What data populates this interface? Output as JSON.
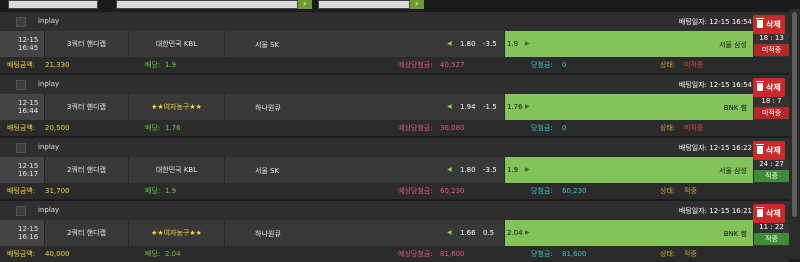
{
  "labels": {
    "inplay": "inplay",
    "delete": "삭제",
    "bet_amount": "배팅금액:",
    "odds": "배당:",
    "expected": "예상당첨금:",
    "won": "당첨금:",
    "status": "상태:"
  },
  "colors": {
    "delete_bg": "#cc2a2a",
    "away_cell_bg": "#83c45a",
    "status_pending": "#b52626",
    "status_won": "#3e8b3a",
    "amount_text": "#f2d43a"
  },
  "bets": [
    {
      "bet_time": "배팅일자: 12-15 16:54",
      "match_date": "12-15",
      "match_time": "16:45",
      "game_type": "3쿼터 핸디캡",
      "league": "대한민국 KBL",
      "home_team": "서울 SK",
      "home_odds": "1.80",
      "handicap": "-3.5",
      "away_odds": "1.9",
      "away_team": "서울 삼성",
      "score": "18 : 13",
      "state": "미적중",
      "state_kind": "red",
      "amount": "21,330",
      "odds": "1.9",
      "expected": "40,527",
      "won": "0",
      "status": "미적중",
      "status_kind": "red"
    },
    {
      "bet_time": "배팅일자: 12-15 16:54",
      "match_date": "12-15",
      "match_time": "16:44",
      "game_type": "3쿼터 핸디캡",
      "league": "★★여자농구★★",
      "home_team": "하나원큐",
      "home_odds": "1.94",
      "handicap": "-1.5",
      "away_odds": "1.76",
      "away_team": "BNK 썸",
      "score": "18 : 7",
      "state": "미적중",
      "state_kind": "red",
      "amount": "20,500",
      "odds": "1.76",
      "expected": "36,080",
      "won": "0",
      "status": "미적중",
      "status_kind": "red"
    },
    {
      "bet_time": "배팅일자: 12-15 16:22",
      "match_date": "12-15",
      "match_time": "16:17",
      "game_type": "2쿼터 핸디캡",
      "league": "대한민국 KBL",
      "home_team": "서울 SK",
      "home_odds": "1.80",
      "handicap": "-3.5",
      "away_odds": "1.9",
      "away_team": "서울 삼성",
      "score": "24 : 27",
      "state": "적중",
      "state_kind": "green",
      "amount": "31,700",
      "odds": "1.9",
      "expected": "60,230",
      "won": "60,230",
      "status": "적중",
      "status_kind": "green"
    },
    {
      "bet_time": "배팅일자: 12-15 16:21",
      "match_date": "12-15",
      "match_time": "16:16",
      "game_type": "2쿼터 핸디캡",
      "league": "★★여자농구★★",
      "home_team": "하나원큐",
      "home_odds": "1.66",
      "handicap": "0.5",
      "away_odds": "2.04",
      "away_team": "BNK 썸",
      "score": "11 : 22",
      "state": "적중",
      "state_kind": "green",
      "amount": "40,000",
      "odds": "2.04",
      "expected": "81,600",
      "won": "81,600",
      "status": "적중",
      "status_kind": "green"
    }
  ]
}
